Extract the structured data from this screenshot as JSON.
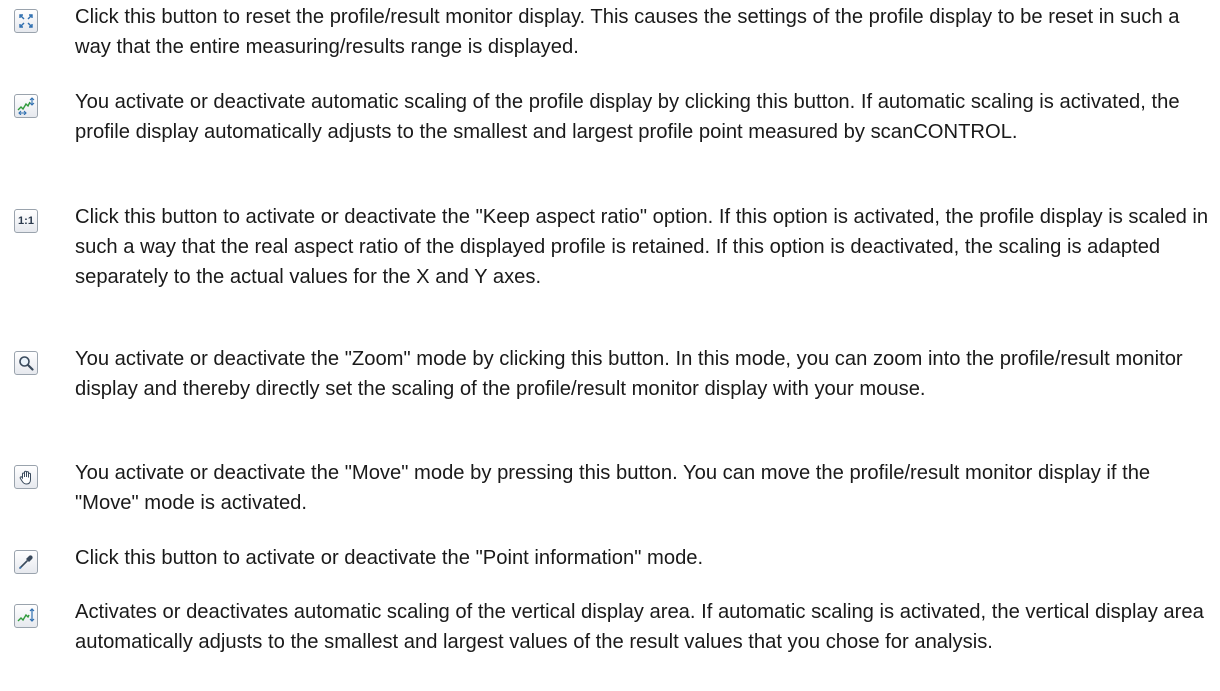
{
  "entries": [
    {
      "icon": "reset-view-icon",
      "text": "Click this button to reset the profile/result monitor display. This causes the settings of the profile display to be reset in such a way that the entire measuring/results range is displayed."
    },
    {
      "icon": "auto-scale-icon",
      "text": "You activate or deactivate automatic scaling of the profile display by clicking this button. If automatic scaling is activated, the profile display automatically adjusts to the smallest and largest profile point measured by scanCONTROL."
    },
    {
      "icon": "aspect-ratio-icon",
      "icon_label": "1:1",
      "text": "Click this button to activate or deactivate the \"Keep aspect ratio\" option. If this option is activated, the profile display is scaled in such a way that the real aspect ratio of the displayed profile is retained. If this option is deactivated, the scaling is adapted separately to the actual values for the X and Y axes."
    },
    {
      "icon": "zoom-icon",
      "text": "You activate or deactivate the \"Zoom\" mode by clicking this button. In this mode, you can zoom into the profile/result monitor display and thereby directly set the scaling of the profile/result monitor display with your mouse."
    },
    {
      "icon": "hand-move-icon",
      "text": "You activate or deactivate the \"Move\" mode by pressing this button. You can move the profile/result monitor display if the \"Move\" mode is activated."
    },
    {
      "icon": "pipette-icon",
      "text": "Click this button to activate or deactivate the \"Point information\" mode."
    },
    {
      "icon": "vertical-auto-scale-icon",
      "text": "Activates or deactivates automatic scaling of the vertical display area. If automatic scaling is activated, the vertical display area automatically adjusts to the smallest and largest values of the result values that you chose for analysis."
    }
  ]
}
